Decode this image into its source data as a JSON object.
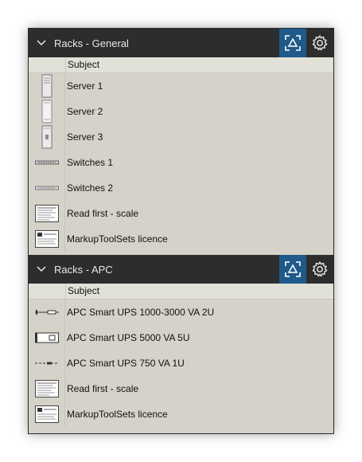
{
  "sections": [
    {
      "title": "Racks - General",
      "column_header": "Subject",
      "items": [
        {
          "label": "Server 1",
          "icon": "server-tower-icon"
        },
        {
          "label": "Server 2",
          "icon": "server-tower-icon"
        },
        {
          "label": "Server 3",
          "icon": "server-tower-icon"
        },
        {
          "label": "Switches 1",
          "icon": "switch-rack-icon"
        },
        {
          "label": "Switches 2",
          "icon": "switch-rack-icon"
        },
        {
          "label": "Read first - scale",
          "icon": "document-thumbnail-icon"
        },
        {
          "label": "MarkupToolSets licence",
          "icon": "document-thumbnail-icon"
        }
      ]
    },
    {
      "title": "Racks - APC",
      "column_header": "Subject",
      "items": [
        {
          "label": "APC Smart UPS 1000-3000 VA 2U",
          "icon": "ups-2u-icon"
        },
        {
          "label": "APC Smart UPS 5000 VA 5U",
          "icon": "ups-5u-icon"
        },
        {
          "label": "APC Smart UPS 750 VA 1U",
          "icon": "ups-1u-icon"
        },
        {
          "label": "Read first - scale",
          "icon": "document-thumbnail-icon"
        },
        {
          "label": "MarkupToolSets licence",
          "icon": "document-thumbnail-icon"
        }
      ]
    }
  ],
  "colors": {
    "header_bg": "#2d2d2d",
    "active_button": "#1f5a8a",
    "panel_bg": "#d4d2c9"
  }
}
